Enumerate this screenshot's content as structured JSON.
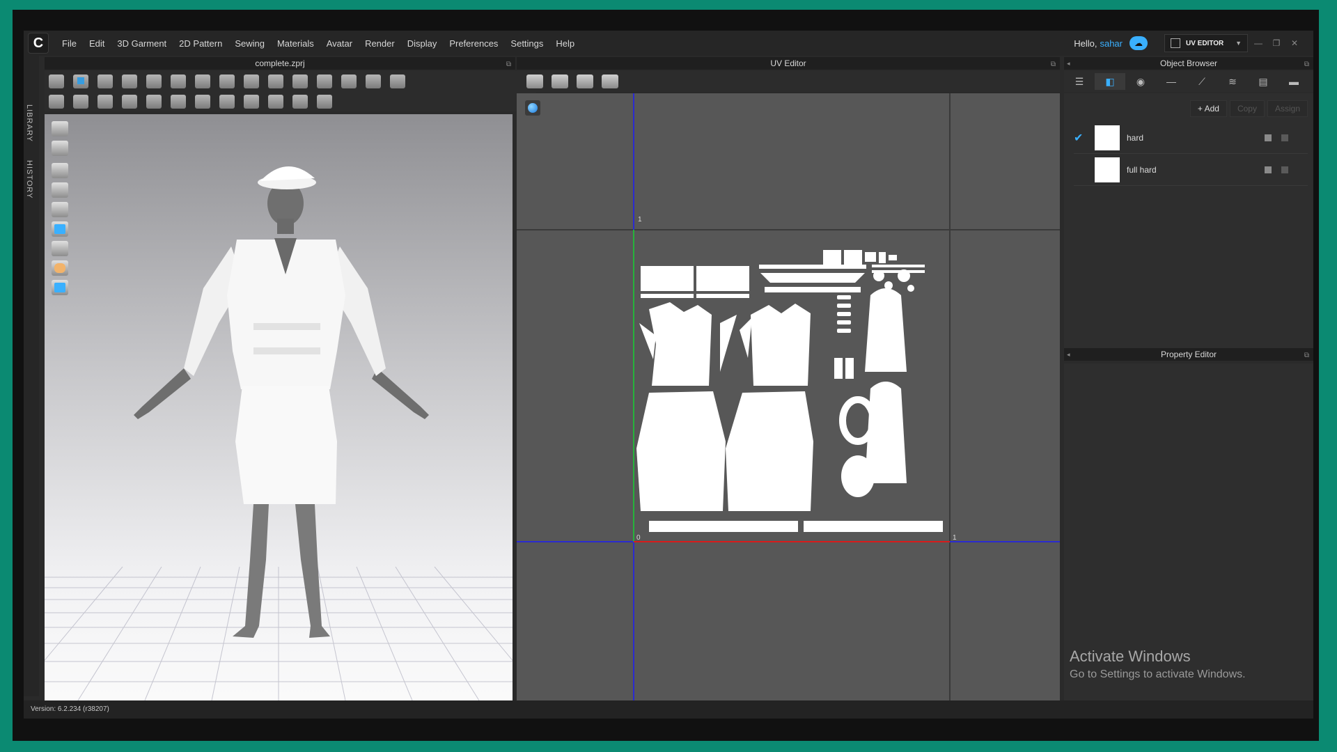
{
  "app": {
    "logo": "C",
    "menu": [
      "File",
      "Edit",
      "3D Garment",
      "2D Pattern",
      "Sewing",
      "Materials",
      "Avatar",
      "Render",
      "Display",
      "Preferences",
      "Settings",
      "Help"
    ],
    "hello_prefix": "Hello,",
    "user": "sahar",
    "mode_label": "UV EDITOR",
    "window_buttons": [
      "—",
      "❐",
      "✕"
    ]
  },
  "side_tabs": [
    "LIBRARY",
    "HISTORY"
  ],
  "view3d": {
    "title": "complete.zprj"
  },
  "uv_editor": {
    "title": "UV Editor",
    "axis_labels": {
      "top_one": "1",
      "origin": "0",
      "right_one": "1"
    },
    "colors": {
      "u_axis": "#d81b1b",
      "v_axis": "#26b33a",
      "grid_line": "#2b2bd0"
    }
  },
  "object_browser": {
    "title": "Object Browser",
    "actions": {
      "add": "+ Add",
      "copy": "Copy",
      "assign": "Assign"
    },
    "materials": [
      {
        "name": "hard",
        "selected": true
      },
      {
        "name": "full hard",
        "selected": false
      }
    ]
  },
  "property_editor": {
    "title": "Property Editor"
  },
  "watermark": {
    "title": "Activate Windows",
    "subtitle": "Go to Settings to activate Windows."
  },
  "status": {
    "version": "Version: 6.2.234 (r38207)"
  },
  "colors": {
    "accent": "#3ab0ff",
    "frame": "#0b8a72"
  }
}
